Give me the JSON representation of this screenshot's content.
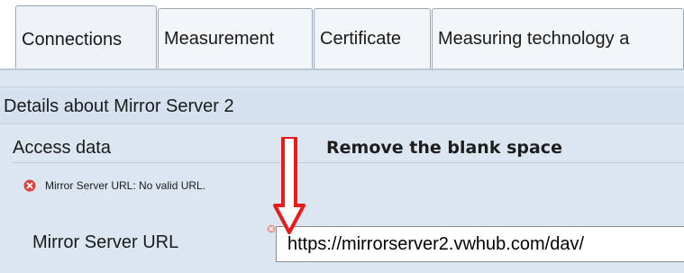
{
  "tabs": [
    {
      "label": "Connections",
      "active": true
    },
    {
      "label": "Measurement",
      "active": false
    },
    {
      "label": "Certificate",
      "active": false
    },
    {
      "label": "Measuring technology a",
      "active": false
    }
  ],
  "details": {
    "title": "Details about Mirror Server 2"
  },
  "access_section": {
    "title": "Access data"
  },
  "annotation": {
    "text": "Remove the blank space",
    "arrow_color": "#e81c1c"
  },
  "validation": {
    "message": "Mirror Server URL: No valid URL.",
    "icon": "error-x-icon",
    "color": "#d9433a"
  },
  "mirror_url_field": {
    "label": "Mirror Server URL",
    "value": "https://mirrorserver2.vwhub.com/dav/"
  }
}
